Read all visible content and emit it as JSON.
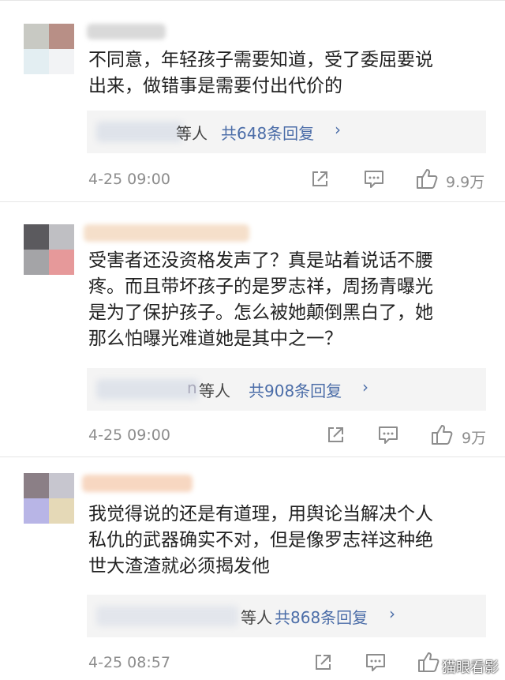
{
  "comments": [
    {
      "text": "不同意，年轻孩子需要知道，受了委屈要说出来，做错事是需要付出代价的",
      "line1": "不同意，年轻孩子需要知道，受了委屈要说",
      "line2": "出来，做错事是需要付出代价的",
      "reply_who": "等人",
      "reply_count": "共648条回复",
      "timestamp": "4-25 09:00",
      "likes": "9.9万",
      "avatar_colors": [
        "#c8c9c3",
        "#b88f86",
        "#e3eef2",
        "#f2f3f5"
      ],
      "name_color": "#d9d9d9"
    },
    {
      "line1": "受害者还没资格发声了？真是站着说话不腰",
      "line2": "疼。而且带坏孩子的是罗志祥，周扬青曝光",
      "line3": "是为了保护孩子。怎么被她颠倒黑白了，她",
      "line4": "那么怕曝光难道她是其中之一？",
      "reply_who": "等人",
      "reply_prefix": "n",
      "reply_count": "共908条回复",
      "timestamp": "4-25 09:00",
      "likes": "9万",
      "avatar_colors": [
        "#5b5a5e",
        "#bfbfc3",
        "#a4a4a7",
        "#e6999a"
      ],
      "name_color": "#f5dfca"
    },
    {
      "line1": "我觉得说的还是有道理，用舆论当解决个人",
      "line2": "私仇的武器确实不对，但是像罗志祥这种绝",
      "line3": "世大渣渣就必须揭发他",
      "reply_who": "等人",
      "reply_count": "共868条回复",
      "timestamp": "4-25 08:57",
      "likes": "",
      "avatar_colors": [
        "#8b7f86",
        "#c7c6cf",
        "#b8b5e6",
        "#e5d9b7"
      ],
      "name_color": "#f7d7c1"
    }
  ],
  "icons": {
    "share": "share-icon",
    "comment": "comment-icon",
    "like": "thumbs-up-icon"
  },
  "watermark": "猫眼看影",
  "colors": {
    "link_blue": "#4b6da8",
    "meta_gray": "#8d8d8d",
    "reply_bg": "#f4f4f4"
  }
}
